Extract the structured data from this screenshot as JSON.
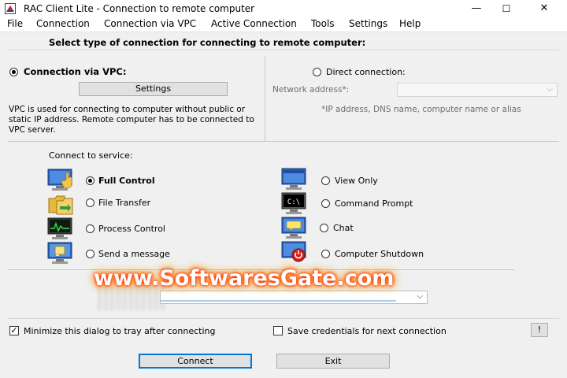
{
  "window": {
    "title": "RAC Client Lite - Connection to remote computer",
    "minimize_glyph": "—",
    "maximize_glyph": "☐",
    "close_glyph": "✕"
  },
  "menu": [
    "File",
    "Connection",
    "Connection via VPC",
    "Active Connection",
    "Tools",
    "Settings",
    "Help"
  ],
  "heading": "Select type of connection for connecting to remote computer:",
  "vpc": {
    "label": "Connection via VPC:",
    "selected": true,
    "settings_button": "Settings",
    "description": "VPC is used for connecting to computer without public or static IP address. Remote computer has to be connected to VPC server."
  },
  "direct": {
    "label": "Direct connection:",
    "selected": false,
    "address_label": "Network address*:",
    "address_value": "",
    "hint": "*IP address, DNS name, computer name or alias"
  },
  "connect_to_service_label": "Connect to service:",
  "services": [
    {
      "label": "Full Control",
      "icon": "full-control-icon",
      "selected": true
    },
    {
      "label": "File Transfer",
      "icon": "file-transfer-icon",
      "selected": false
    },
    {
      "label": "Process Control",
      "icon": "process-control-icon",
      "selected": false
    },
    {
      "label": "Send a message",
      "icon": "send-message-icon",
      "selected": false
    },
    {
      "label": "View Only",
      "icon": "view-only-icon",
      "selected": false
    },
    {
      "label": "Command Prompt",
      "icon": "command-prompt-icon",
      "selected": false
    },
    {
      "label": "Chat",
      "icon": "chat-icon",
      "selected": false
    },
    {
      "label": "Computer Shutdown",
      "icon": "computer-shutdown-icon",
      "selected": false
    }
  ],
  "command_prompt_icon_text": "C:\\",
  "watermark": "www.SoftwaresGate.com",
  "options": {
    "minimize_to_tray": {
      "label": "Minimize this dialog to tray after connecting",
      "checked": true
    },
    "save_credentials": {
      "label": "Save credentials for next connection",
      "checked": false
    },
    "info_button": "!"
  },
  "buttons": {
    "connect": "Connect",
    "exit": "Exit"
  },
  "colors": {
    "accent": "#0078d7",
    "watermark_glow": "#ff4a00"
  }
}
